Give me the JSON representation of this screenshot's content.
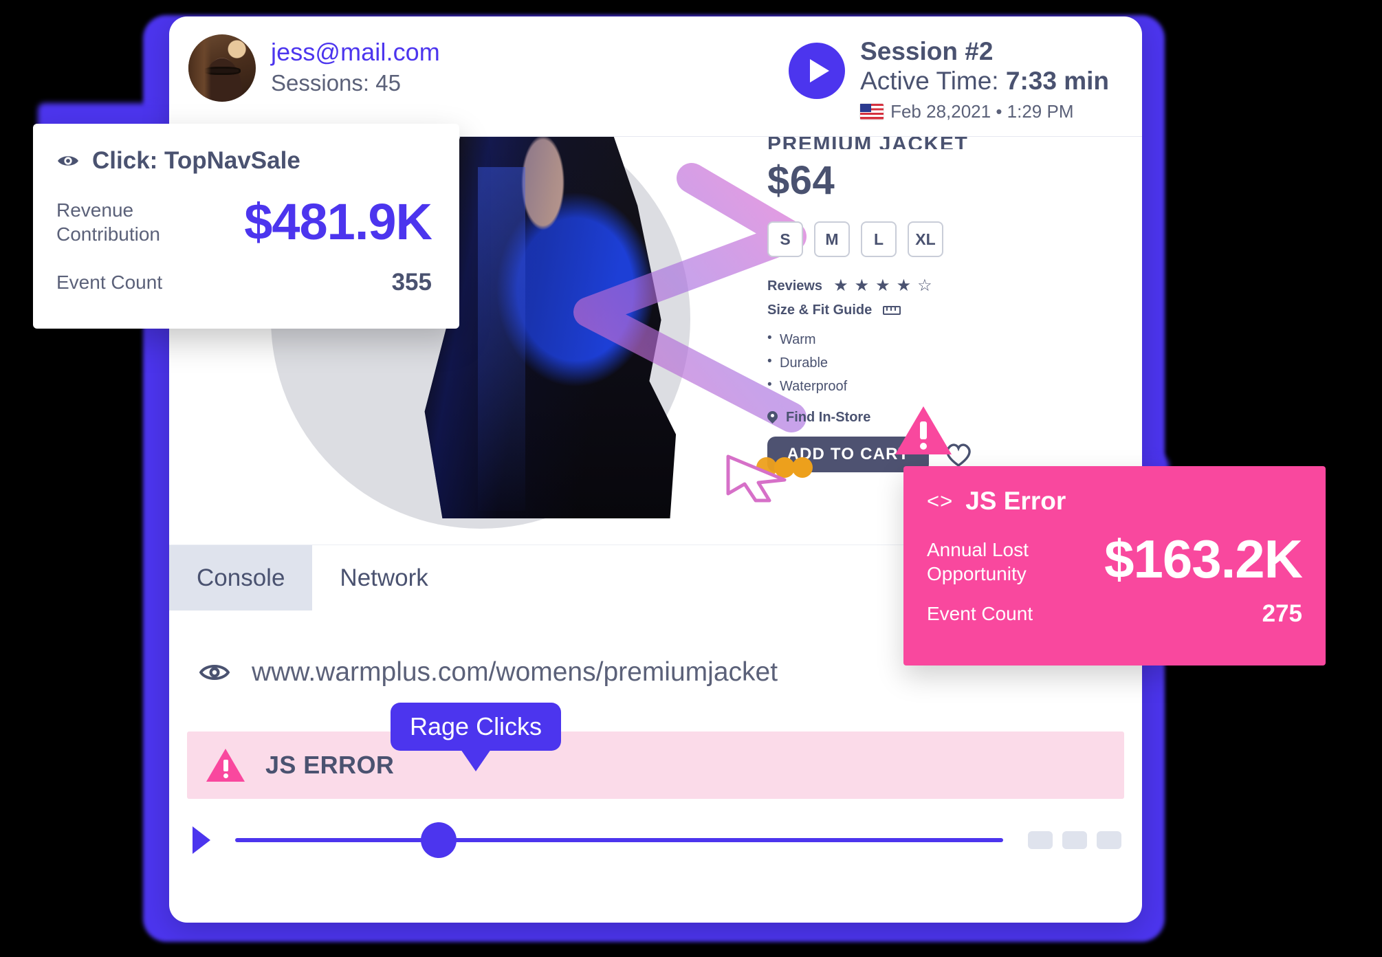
{
  "frame": {
    "accent_purple": "#4c35ee",
    "accent_pink": "#f9489e",
    "background": "#000000"
  },
  "header": {
    "user_email": "jess@mail.com",
    "sessions": "Sessions: 45",
    "play_icon": "play-icon",
    "session_title": "Session #2",
    "active_time_label": "Active Time:",
    "active_time_value": "7:33 min",
    "flag_icon": "us-flag-icon",
    "date": "Feb 28,2021 • 1:29 PM"
  },
  "product": {
    "name": "PREMIUM JACKET",
    "price": "$64",
    "sizes": [
      "S",
      "M",
      "L",
      "XL"
    ],
    "reviews_label": "Reviews",
    "rating_filled": 4,
    "rating_total": 5,
    "fit_label": "Size & Fit Guide",
    "fit_icon": "ruler-icon",
    "features": [
      "Warm",
      "Durable",
      "Waterproof"
    ],
    "find_in_store": "Find In-Store",
    "find_in_store_icon": "map-pin-icon",
    "add_to_cart": "ADD TO CART",
    "wishlist_icon": "heart-icon",
    "warning_icon": "warning-triangle-icon",
    "cursor_icon": "cursor-arrow-icon"
  },
  "devtools": {
    "tabs": [
      {
        "label": "Console",
        "active": true
      },
      {
        "label": "Network",
        "active": false
      }
    ]
  },
  "url_bar": {
    "eye_icon": "eye-icon",
    "url": "www.warmplus.com/womens/premiumjacket"
  },
  "error_bar": {
    "icon": "warning-triangle-icon",
    "label": "JS ERROR",
    "bubble_label": "Rage Clicks"
  },
  "timeline": {
    "play_icon": "play-icon",
    "scrubber_position_percent": 26,
    "thumbnail_count": 3
  },
  "click_tooltip": {
    "eye_icon": "eye-icon",
    "title": "Click: TopNavSale",
    "metric_label": "Revenue Contribution",
    "metric_value": "$481.9K",
    "count_label": "Event Count",
    "count_value": "355"
  },
  "js_error_tooltip": {
    "code_icon": "<>",
    "title": "JS Error",
    "metric_label": "Annual Lost Opportunity",
    "metric_value": "$163.2K",
    "count_label": "Event Count",
    "count_value": "275"
  }
}
